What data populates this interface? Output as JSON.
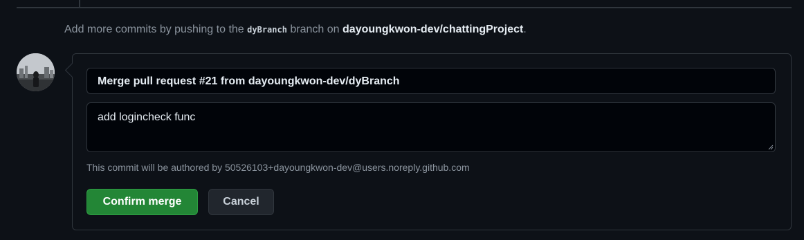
{
  "push_hint": {
    "prefix": "Add more commits by pushing to the",
    "branch": "dyBranch",
    "middle": "branch on",
    "repo": "dayoungkwon-dev/chattingProject",
    "suffix": "."
  },
  "merge_form": {
    "commit_title": "Merge pull request #21 from dayoungkwon-dev/dyBranch",
    "commit_body": "add logincheck func",
    "author_note": "This commit will be authored by 50526103+dayoungkwon-dev@users.noreply.github.com",
    "confirm_label": "Confirm merge",
    "cancel_label": "Cancel"
  },
  "colors": {
    "background": "#0d1117",
    "border": "#30363d",
    "confirm_button": "#238636",
    "cancel_button": "#21262d",
    "muted_text": "#8b949e"
  }
}
